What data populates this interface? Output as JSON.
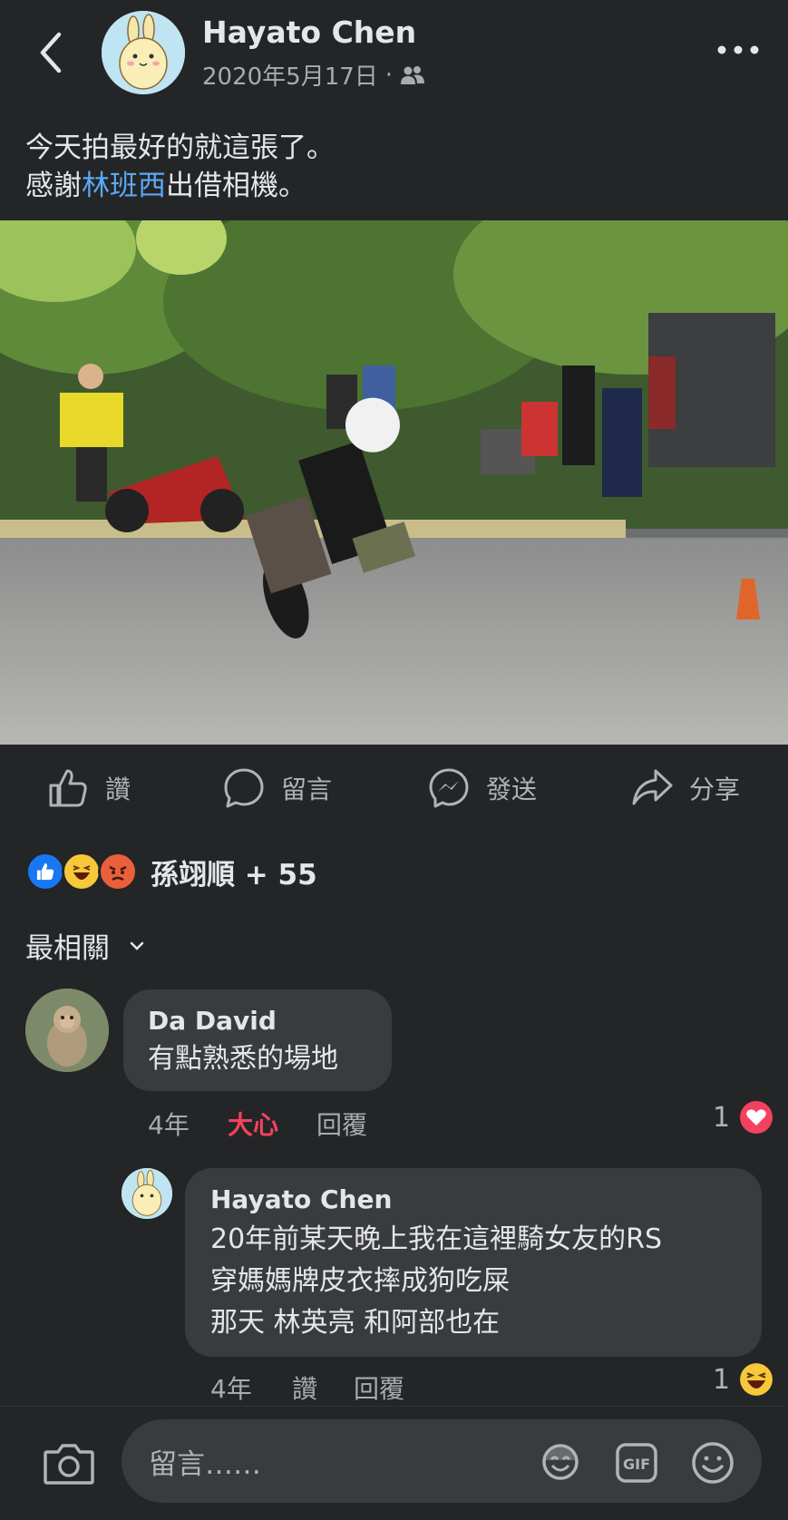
{
  "header": {
    "author": "Hayato Chen",
    "date": "2020年5月17日",
    "separator": "·",
    "audience_icon": "friends-icon",
    "more_icon": "more-icon"
  },
  "post": {
    "line1": "今天拍最好的就這張了。",
    "line2_prefix": "感謝",
    "tagged": "林班西",
    "line2_suffix": "出借相機。"
  },
  "actions": {
    "like": "讚",
    "comment": "留言",
    "send": "發送",
    "share": "分享"
  },
  "reactions": {
    "types": [
      "like",
      "haha",
      "angry"
    ],
    "summary": "孫翊順 + 55"
  },
  "sort": {
    "label": "最相關"
  },
  "comments": [
    {
      "name": "Da David",
      "text": "有點熟悉的場地",
      "time": "4年",
      "reaction_label": "大心",
      "reply_label": "回覆",
      "reaction_count": "1",
      "reaction_type": "love"
    },
    {
      "name": "Hayato Chen",
      "lines": [
        "20年前某天晚上我在這裡騎女友的RS",
        "穿媽媽牌皮衣摔成狗吃屎",
        "那天 林英亮 和阿部也在"
      ],
      "time": "4年",
      "reaction_label": "讚",
      "reply_label": "回覆",
      "reaction_count": "1",
      "reaction_type": "haha"
    }
  ],
  "composer": {
    "placeholder": "留言……",
    "gif_label": "GIF"
  },
  "colors": {
    "background": "#242526",
    "bubble": "#3a3b3c",
    "link": "#5aa9f5",
    "love": "#f3425f",
    "like": "#1877f2"
  }
}
